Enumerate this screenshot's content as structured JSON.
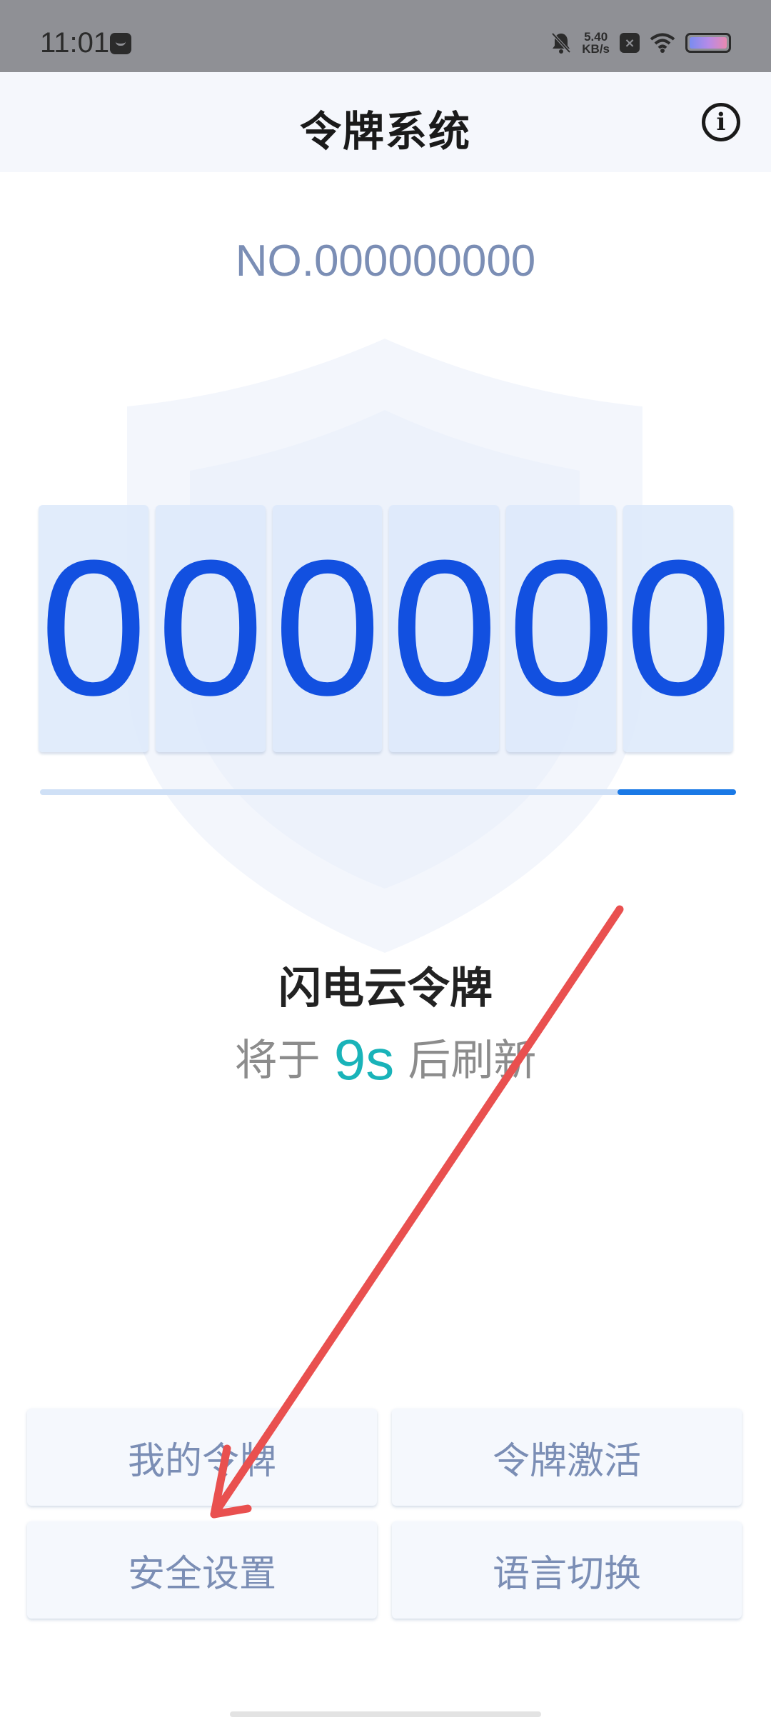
{
  "status_bar": {
    "time": "11:01",
    "net_speed_value": "5.40",
    "net_speed_unit": "KB/s",
    "icons": [
      "notification-app-icon",
      "bell-muted-icon",
      "x-box-icon",
      "wifi-icon",
      "battery-icon"
    ]
  },
  "header": {
    "title": "令牌系统",
    "info_glyph": "i"
  },
  "token": {
    "serial": "NO.000000000",
    "digits": [
      "0",
      "0",
      "0",
      "0",
      "0",
      "0"
    ],
    "progress_remaining_fraction": 0.17,
    "name": "闪电云令牌",
    "refresh_prefix": "将于",
    "refresh_seconds": "9s",
    "refresh_suffix": "后刷新"
  },
  "menu": {
    "my_token": "我的令牌",
    "activate": "令牌激活",
    "security": "安全设置",
    "language": "语言切换"
  },
  "colors": {
    "accent_blue": "#1250e0",
    "progress_blue": "#1a79e6",
    "countdown_teal": "#19b3b9",
    "annotation_red": "#e9504f"
  }
}
